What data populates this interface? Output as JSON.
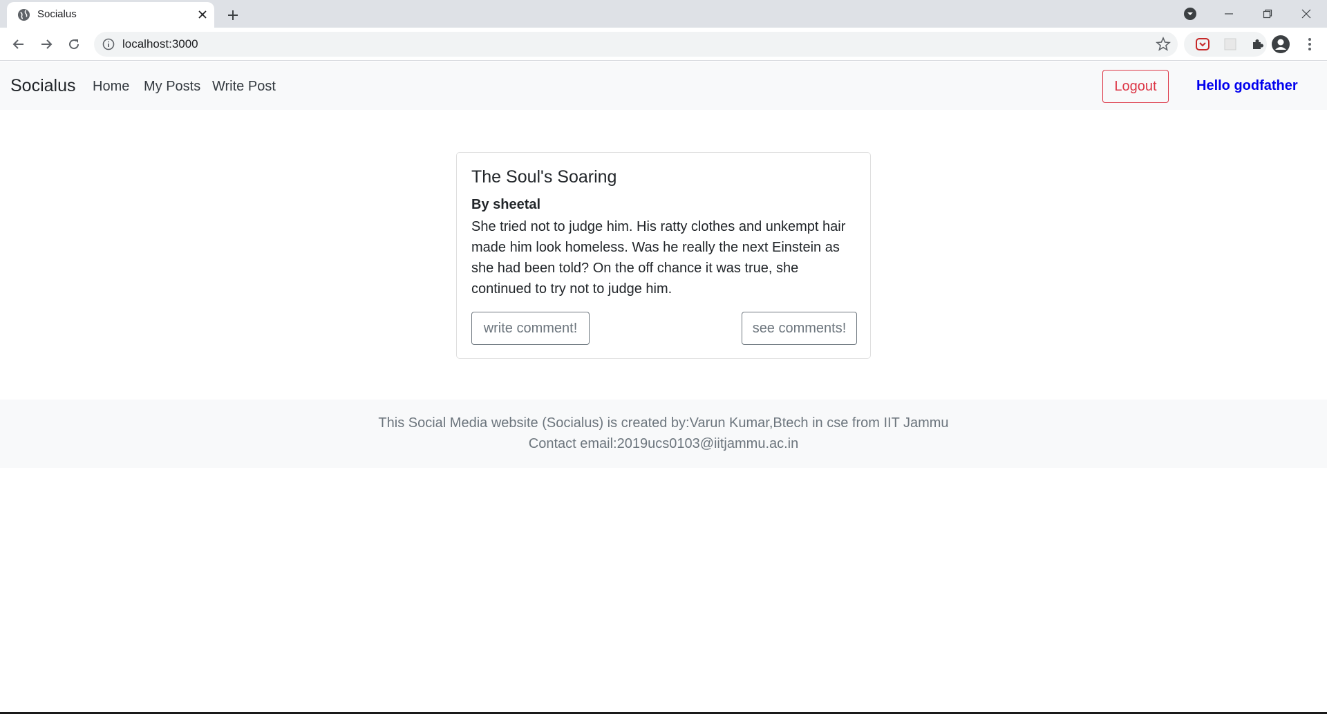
{
  "browser": {
    "tab_title": "Socialus",
    "url": "localhost:3000"
  },
  "navbar": {
    "brand": "Socialus",
    "links": [
      "Home",
      "My Posts",
      "Write Post"
    ],
    "logout_label": "Logout",
    "greeting": "Hello godfather"
  },
  "post": {
    "title": "The Soul's Soaring",
    "author": "By sheetal",
    "body_lines": [
      "She tried not to judge him. His ratty clothes and unkempt hair",
      "made him look homeless. Was he really the next Einstein as",
      "she had been told? On the off chance it was true, she",
      "continued to try not to judge him."
    ],
    "write_comment_label": "write comment!",
    "see_comments_label": "see comments!"
  },
  "footer": {
    "line1": "This Social Media website (Socialus) is created by:Varun Kumar,Btech in cse from IIT Jammu",
    "line2": "Contact email:2019ucs0103@iitjammu.ac.in"
  },
  "colors": {
    "logout": "#dc3545",
    "greeting": "#0000ee",
    "muted": "#6c757d"
  },
  "icons": {
    "tab": "globe-icon",
    "close": "close-icon",
    "new_tab": "plus-icon",
    "back": "back-arrow-icon",
    "forward": "forward-arrow-icon",
    "reload": "reload-icon",
    "info": "info-icon",
    "bookmark": "star-icon",
    "extensions": "puzzle-icon",
    "profile": "account-icon",
    "menu": "kebab-menu-icon"
  }
}
